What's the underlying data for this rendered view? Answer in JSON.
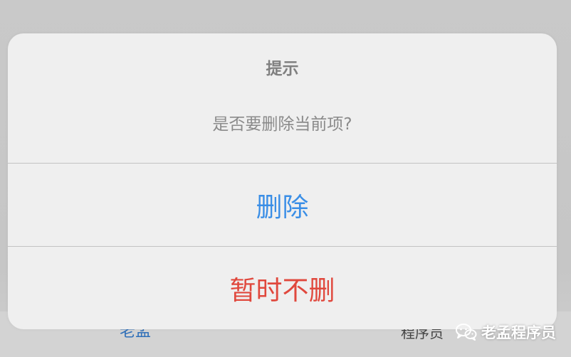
{
  "background": {
    "left_label": "老孟",
    "right_label": "程序员"
  },
  "watermark": {
    "icon": "wechat-icon",
    "text": "老孟程序员"
  },
  "dialog": {
    "title": "提示",
    "message": "是否要删除当前项?",
    "actions": {
      "confirm_label": "删除",
      "cancel_label": "暂时不删"
    }
  },
  "colors": {
    "confirm": "#3a8ee6",
    "cancel": "#e0483d",
    "dialog_bg": "#efefef",
    "overlay": "#c8c8c8"
  }
}
